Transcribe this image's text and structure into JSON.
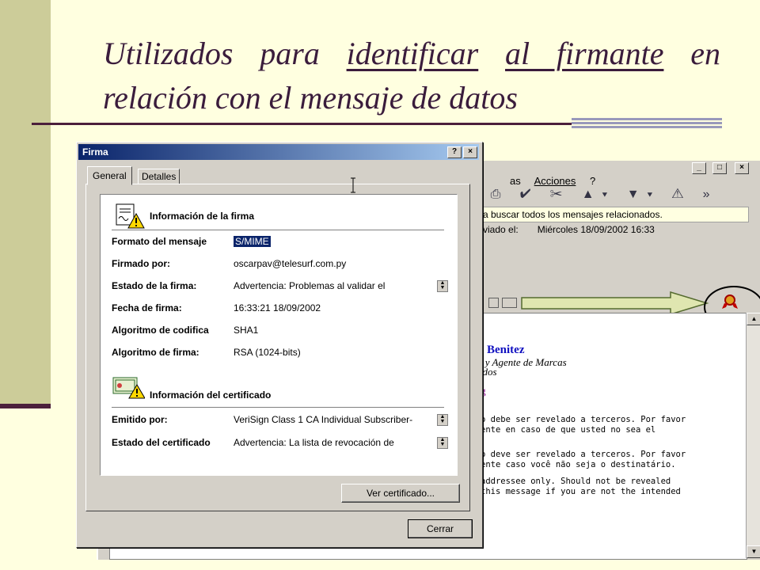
{
  "slide": {
    "title_part1": "Utilizados para ",
    "title_u1": "identificar",
    "title_sp": " ",
    "title_u2": "al firmante",
    "title_part2": " en relación con el mensaje de datos"
  },
  "background_window": {
    "menu": [
      "as",
      "Acciones",
      "?"
    ],
    "window_buttons": [
      "_",
      "□",
      "×"
    ],
    "toolbar_glyphs": "▪⎙ ✔ ✂ ▲▾ ▼▾ ⚠ »",
    "banner_text": "a buscar todos los mensajes relacionados.",
    "sent_label": "viado el:",
    "sent_value": "Miércoles 18/09/2002 16:33",
    "signature": {
      "name": "Benitez",
      "line1": "o y Agente de Marcas",
      "line2": "ados",
      "line3": "y",
      "link": "rg"
    },
    "body_lines": [
      "o debe ser revelado a terceros. Por favor",
      "ente en caso de que usted no sea el",
      "",
      "o deve ser revelado a terceros. Por favor",
      "ente caso você não seja o destinatário.",
      "",
      " addressee only. Should not be revealed",
      "this message if you are not the intended"
    ]
  },
  "dialog": {
    "title": "Firma",
    "help_label": "?",
    "close_label": "×",
    "tabs": [
      "General",
      "Detalles"
    ],
    "signature_section": "Información de la firma",
    "certificate_section": "Información del certificado",
    "fields": [
      {
        "label": "Formato del mensaje",
        "value": "S/MIME"
      },
      {
        "label": "Firmado por:",
        "value": "oscarpav@telesurf.com.py"
      },
      {
        "label": "Estado de la firma:",
        "value": "Advertencia: Problemas al validar el"
      },
      {
        "label": "Fecha de firma:",
        "value": "16:33:21 18/09/2002"
      },
      {
        "label": "Algoritmo de codifica",
        "value": "SHA1"
      },
      {
        "label": "Algoritmo de firma:",
        "value": "RSA (1024-bits)"
      }
    ],
    "cert_fields": [
      {
        "label": "Emitido por:",
        "value": "VeriSign Class 1 CA Individual Subscriber-"
      },
      {
        "label": "Estado del certificado",
        "value": "Advertencia: La lista de revocación de"
      }
    ],
    "view_cert_button": "Ver certificado...",
    "close_button": "Cerrar"
  },
  "colors": {
    "slide_background": "#ffffe0",
    "title_color": "#3a1c3c",
    "dialog_titlebar": "#0a246a",
    "signature_name": "#1010c0"
  }
}
